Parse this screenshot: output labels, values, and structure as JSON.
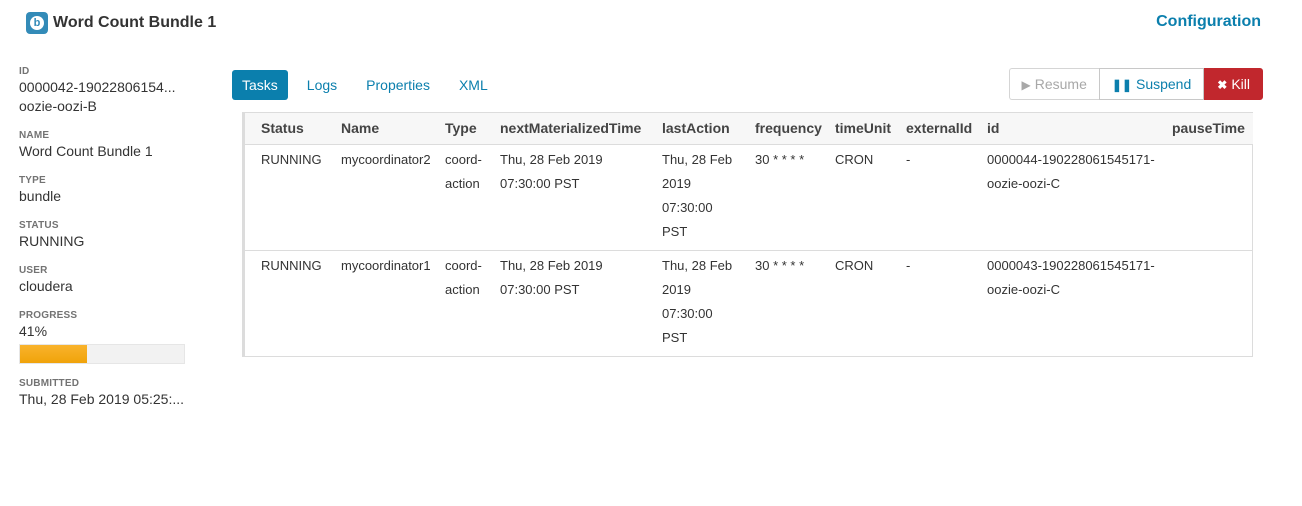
{
  "header": {
    "icon_letter": "b",
    "title": "Word Count Bundle 1",
    "config_label": "Configuration"
  },
  "sidebar": {
    "id_label": "ID",
    "id_value": "0000042-19022806154...",
    "id_value2": "oozie-oozi-B",
    "name_label": "NAME",
    "name_value": "Word Count Bundle 1",
    "type_label": "TYPE",
    "type_value": "bundle",
    "status_label": "STATUS",
    "status_value": "RUNNING",
    "user_label": "USER",
    "user_value": "cloudera",
    "progress_label": "PROGRESS",
    "progress_value": "41%",
    "progress_fraction": 0.41,
    "submitted_label": "SUBMITTED",
    "submitted_value": "Thu, 28 Feb 2019 05:25:..."
  },
  "tabs": [
    "Tasks",
    "Logs",
    "Properties",
    "XML"
  ],
  "actions": {
    "resume": "Resume",
    "suspend": "Suspend",
    "kill": "Kill"
  },
  "colors": {
    "accent": "#0b7fad",
    "danger": "#c1272d",
    "progress": "#f0a30a"
  },
  "table": {
    "columns": [
      "Status",
      "Name",
      "Type",
      "nextMaterializedTime",
      "lastAction",
      "frequency",
      "timeUnit",
      "externalId",
      "id",
      "pauseTime"
    ],
    "rows": [
      {
        "status": "RUNNING",
        "name": "mycoordinator2",
        "type_a": "coord-",
        "type_b": "action",
        "next_a": "Thu, 28 Feb 2019",
        "next_b": "07:30:00 PST",
        "last_a": "Thu, 28 Feb",
        "last_b": "2019",
        "last_c": "07:30:00 PST",
        "frequency": "30 * * * *",
        "time_unit": "CRON",
        "external_id": "-",
        "id_a": "0000044-190228061545171-",
        "id_b": "oozie-oozi-C",
        "pause_time": ""
      },
      {
        "status": "RUNNING",
        "name": "mycoordinator1",
        "type_a": "coord-",
        "type_b": "action",
        "next_a": "Thu, 28 Feb 2019",
        "next_b": "07:30:00 PST",
        "last_a": "Thu, 28 Feb",
        "last_b": "2019",
        "last_c": "07:30:00 PST",
        "frequency": "30 * * * *",
        "time_unit": "CRON",
        "external_id": "-",
        "id_a": "0000043-190228061545171-",
        "id_b": "oozie-oozi-C",
        "pause_time": ""
      }
    ]
  }
}
